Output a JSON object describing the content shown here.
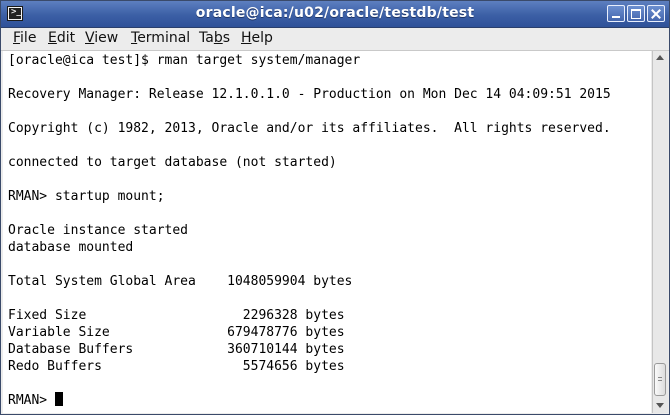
{
  "window": {
    "title": "oracle@ica:/u02/oracle/testdb/test",
    "icon": "terminal-icon",
    "prompt_glyph": ">_"
  },
  "menu": [
    {
      "u": "F",
      "rest": "ile"
    },
    {
      "u": "E",
      "rest": "dit"
    },
    {
      "u": "V",
      "rest": "iew"
    },
    {
      "u": "T",
      "rest": "erminal"
    },
    {
      "pre": "Ta",
      "u": "b",
      "rest": "s"
    },
    {
      "u": "H",
      "rest": "elp"
    }
  ],
  "terminal": {
    "lines": [
      "[oracle@ica test]$ rman target system/manager",
      "",
      "Recovery Manager: Release 12.1.0.1.0 - Production on Mon Dec 14 04:09:51 2015",
      "",
      "Copyright (c) 1982, 2013, Oracle and/or its affiliates.  All rights reserved.",
      "",
      "connected to target database (not started)",
      "",
      "RMAN> startup mount;",
      "",
      "Oracle instance started",
      "database mounted",
      "",
      "Total System Global Area    1048059904 bytes",
      "",
      "Fixed Size                    2296328 bytes",
      "Variable Size               679478776 bytes",
      "Database Buffers            360710144 bytes",
      "Redo Buffers                  5574656 bytes",
      "",
      "RMAN> "
    ]
  },
  "colors": {
    "titlebar": "#3b5fa5",
    "terminal_bg": "#ffffff",
    "terminal_fg": "#000000"
  }
}
